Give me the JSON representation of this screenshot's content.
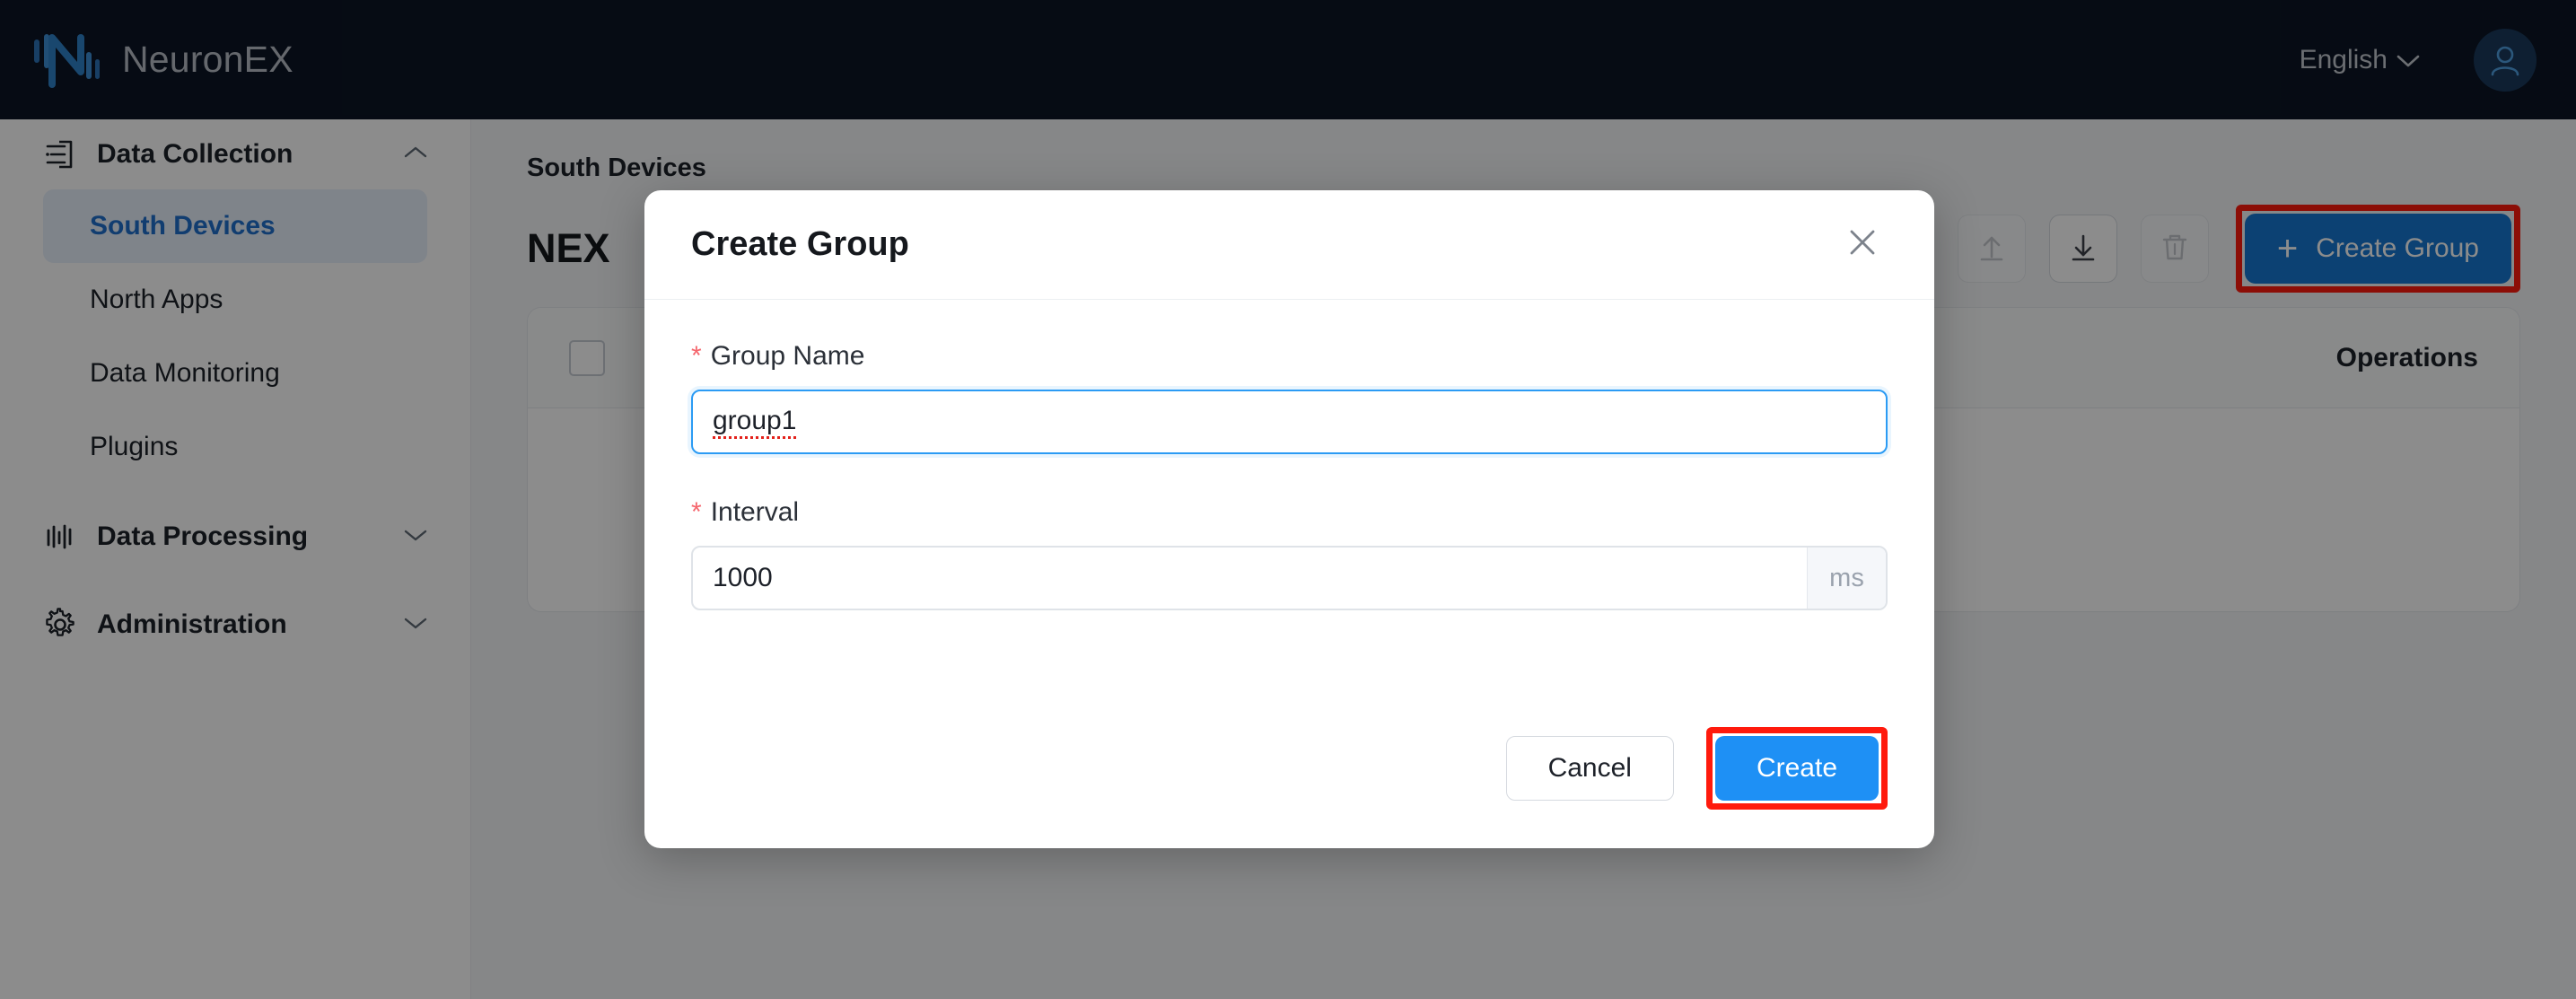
{
  "topbar": {
    "logo_icon": "neuronex-logo-icon",
    "brand": "NeuronEX",
    "language": "English",
    "chevron": "⌄",
    "avatar_icon": "user-avatar-icon"
  },
  "sidebar": {
    "groups": [
      {
        "label": "Data Collection",
        "icon": "data-collection-icon",
        "expanded": true,
        "chevron": "⌃",
        "items": [
          {
            "label": "South Devices",
            "active": true
          },
          {
            "label": "North Apps",
            "active": false
          },
          {
            "label": "Data Monitoring",
            "active": false
          },
          {
            "label": "Plugins",
            "active": false
          }
        ]
      },
      {
        "label": "Data Processing",
        "icon": "data-processing-icon",
        "expanded": false,
        "chevron": "⌄",
        "items": []
      },
      {
        "label": "Administration",
        "icon": "administration-gear-icon",
        "expanded": false,
        "chevron": "⌄",
        "items": []
      }
    ]
  },
  "main": {
    "breadcrumb": "South Devices",
    "page_title": "NEX",
    "actions": {
      "upload_icon": "upload-icon",
      "download_icon": "download-icon",
      "delete_icon": "trash-icon",
      "create_group_label": "Create Group",
      "create_group_plus": "+"
    },
    "table": {
      "select_all": "",
      "columns": [
        "Operations"
      ]
    }
  },
  "modal": {
    "title": "Create Group",
    "close_icon": "close-icon",
    "fields": [
      {
        "label": "Group Name",
        "required_marker": "*",
        "value": "group1",
        "placeholder": "",
        "suffix": "",
        "focused": true,
        "misspelled": true
      },
      {
        "label": "Interval",
        "required_marker": "*",
        "value": "1000",
        "placeholder": "",
        "suffix": "ms",
        "focused": false,
        "misspelled": false
      }
    ],
    "cancel_label": "Cancel",
    "create_label": "Create"
  },
  "colors": {
    "brand_dark": "#0b1525",
    "accent_blue": "#1677d2",
    "primary_blue": "#1e90f5",
    "highlight_red": "#ff1a0d",
    "required_red": "#f5666d",
    "sidebar_active_text": "#1f6fcc"
  }
}
